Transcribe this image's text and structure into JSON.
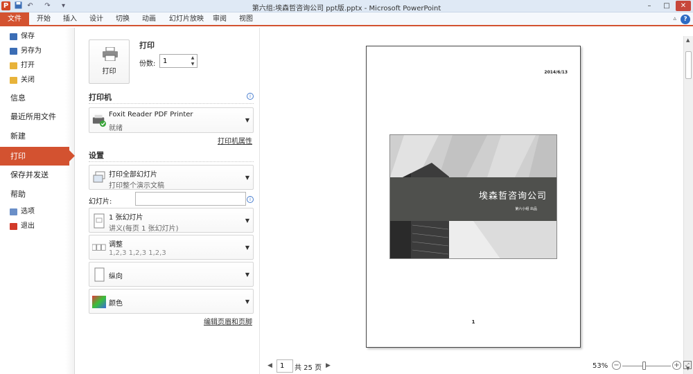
{
  "titlebar": {
    "title": "第六组:埃森哲咨询公司 ppt版.pptx - Microsoft PowerPoint",
    "app_icon": "P",
    "quick_access": [
      "save-icon",
      "undo-icon",
      "redo-icon",
      "customize-icon"
    ],
    "window_buttons": [
      "–",
      "□",
      "✕"
    ]
  },
  "ribbon": {
    "file_tab": "文件",
    "tabs": [
      "开始",
      "插入",
      "设计",
      "切换",
      "动画",
      "幻灯片放映",
      "审阅",
      "视图"
    ],
    "help": "?",
    "collapse": "▵"
  },
  "nav": {
    "commands_top": [
      {
        "label": "保存",
        "icon": "save-icon",
        "color": "#3b6db5"
      },
      {
        "label": "另存为",
        "icon": "save-as-icon",
        "color": "#3b6db5"
      },
      {
        "label": "打开",
        "icon": "open-folder-icon",
        "color": "#e8b33a"
      },
      {
        "label": "关闭",
        "icon": "close-folder-icon",
        "color": "#e8b33a"
      }
    ],
    "tabs": [
      "信息",
      "最近所用文件",
      "新建",
      "打印",
      "保存并发送",
      "帮助"
    ],
    "active_tab": "打印",
    "commands_bottom": [
      {
        "label": "选项",
        "icon": "options-icon",
        "color": "#6a8fc8"
      },
      {
        "label": "退出",
        "icon": "exit-icon",
        "color": "#d23a2a"
      }
    ]
  },
  "print": {
    "button_label": "打印",
    "heading": "打印",
    "copies_label": "份数:",
    "copies_value": "1"
  },
  "printer": {
    "heading": "打印机",
    "name": "Foxit Reader PDF Printer",
    "status": "就绪",
    "properties_link": "打印机属性"
  },
  "settings": {
    "heading": "设置",
    "range_main": "打印全部幻灯片",
    "range_sub": "打印整个演示文稿",
    "slides_label": "幻灯片:",
    "slides_value": "",
    "layout_main": "1 张幻灯片",
    "layout_sub": "讲义(每页 1 张幻灯片)",
    "collate_main": "调整",
    "collate_sub": "1,2,3    1,2,3    1,2,3",
    "orientation": "纵向",
    "color": "颜色",
    "header_footer_link": "编辑页眉和页脚"
  },
  "preview": {
    "date": "2014/6/13",
    "slide_title": "埃森哲咨询公司",
    "slide_subtitle": "第六小组 出品",
    "page_number": "1",
    "current_page": "1",
    "total_pages": "共 25 页",
    "zoom_percent": 53
  },
  "colors": {
    "accent": "#d35230",
    "band": "#4f504d"
  }
}
